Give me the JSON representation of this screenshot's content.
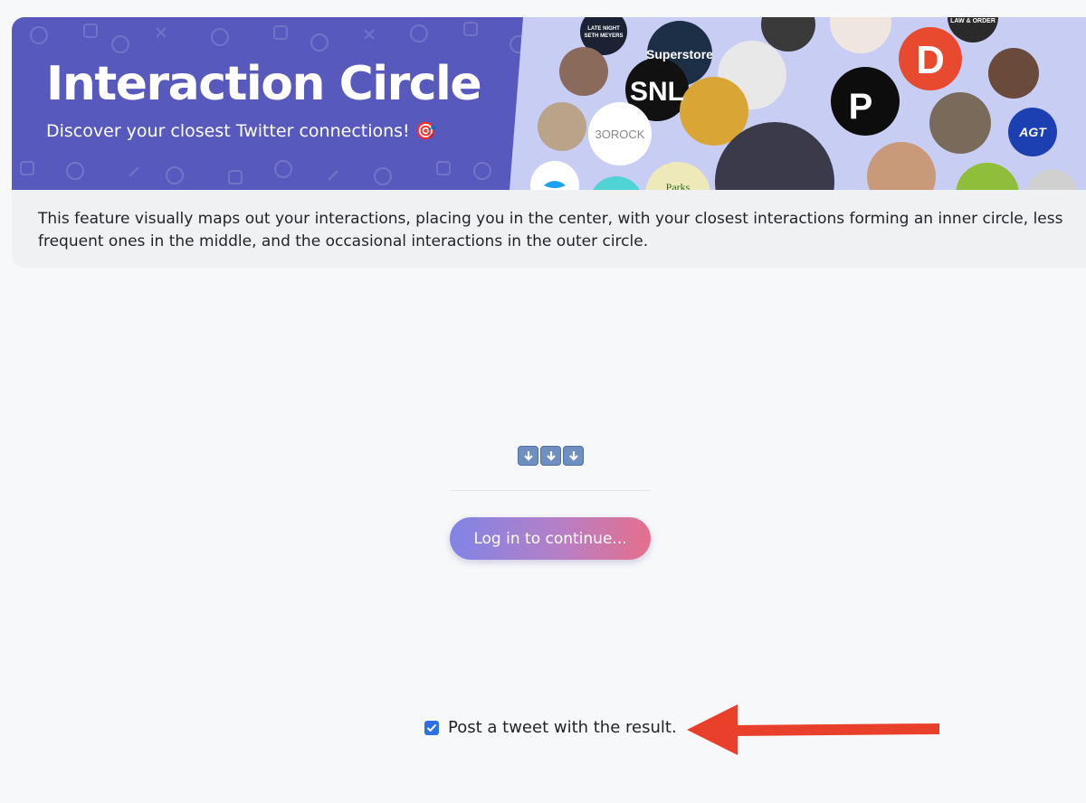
{
  "header": {
    "title": "Interaction Circle",
    "subtitle": "Discover your closest Twitter connections!",
    "subtitle_emoji": "🎯"
  },
  "collage": {
    "badges": [
      {
        "label": "Superstore",
        "bg": "#1d2e47",
        "fg": "#ffffff"
      },
      {
        "label": "SNL",
        "bg": "#111111",
        "fg": "#ffffff"
      },
      {
        "label": "3OROCK",
        "bg": "#ffffff",
        "fg": "#888888"
      },
      {
        "label": "Parks",
        "bg": "#eee9b8",
        "fg": "#2b6b2b"
      },
      {
        "label": "AGT",
        "bg": "#1c3fb2",
        "fg": "#ffffff"
      },
      {
        "label": "LAW & ORDER",
        "bg": "#222222",
        "fg": "#dddddd"
      },
      {
        "label": "LATE NIGHT SETH MEYERS",
        "bg": "#1a2233",
        "fg": "#ffffff"
      }
    ]
  },
  "description": {
    "text": "This feature visually maps out your interactions, placing you in the center, with your closest interactions forming an inner circle, less frequent ones in the middle, and the occasional interactions in the outer circle."
  },
  "main": {
    "arrows_icon": "down-arrow-keycap-icon",
    "login_button_label": "Log in to continue...",
    "tweet_checkbox_checked": true,
    "tweet_checkbox_label": "Post a tweet with the result."
  },
  "colors": {
    "banner": "#5859bc",
    "button_gradient_start": "#8084e6",
    "button_gradient_end": "#e56f8b",
    "checkbox": "#2f6fe4",
    "annotation_arrow": "#e8402a"
  }
}
